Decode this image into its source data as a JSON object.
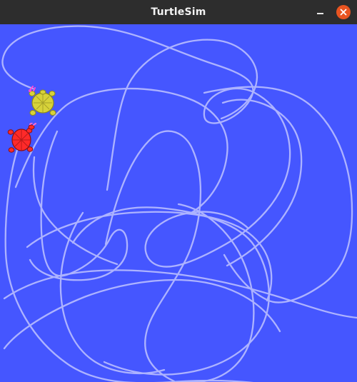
{
  "window": {
    "title": "TurtleSim",
    "background_color": "#4556ff",
    "titlebar_color": "#2d2d2d",
    "pen_color": "#b3b8ff",
    "controls": {
      "minimize_icon": "minimize-icon",
      "close_icon": "close-icon",
      "close_color": "#e95420"
    }
  },
  "turtles": [
    {
      "name": "turtle-yellow",
      "body_color": "#d7d23a",
      "shell_color": "#b9b21f"
    },
    {
      "name": "turtle-red",
      "body_color": "#ff2a2a",
      "shell_color": "#c31a1a"
    }
  ]
}
